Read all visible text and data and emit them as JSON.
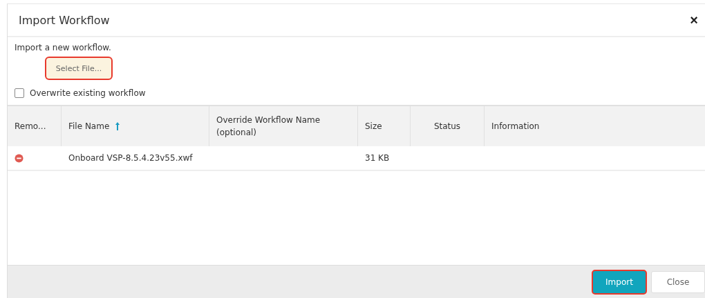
{
  "dialog": {
    "title": "Import Workflow",
    "close_glyph": "×"
  },
  "intro": "Import a new workflow.",
  "select_button": {
    "label": "Select File...",
    "highlighted": true
  },
  "overwrite": {
    "label": "Overwrite existing workflow",
    "checked": false
  },
  "table": {
    "columns": [
      {
        "label": "Remo...",
        "sorted": false
      },
      {
        "label": "File Name",
        "sorted": true
      },
      {
        "label": "Override Workflow Name (optional)",
        "sorted": false
      },
      {
        "label": "Size",
        "sorted": false
      },
      {
        "label": "Status",
        "sorted": false
      },
      {
        "label": "Information",
        "sorted": false
      }
    ],
    "rows": [
      {
        "file_name": "Onboard VSP-8.5.4.23v55.xwf",
        "override": "",
        "size": "31 KB",
        "status": "",
        "information": ""
      }
    ]
  },
  "footer": {
    "buttons": [
      {
        "label": "Import",
        "kind": "primary",
        "highlighted": true
      },
      {
        "label": "Close",
        "kind": "secondary",
        "highlighted": false
      }
    ]
  }
}
